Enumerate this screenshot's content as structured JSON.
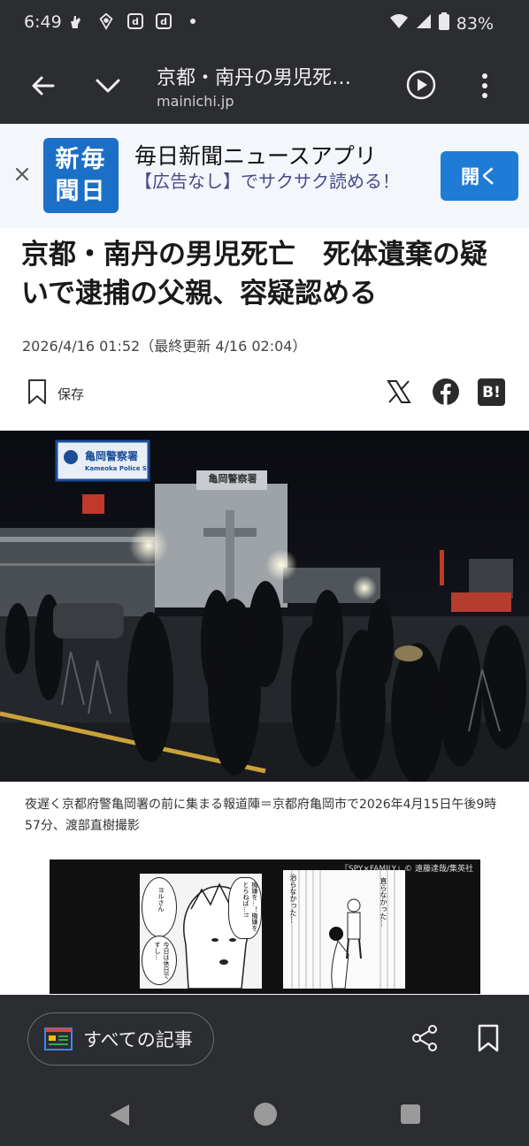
{
  "status_bar": {
    "time": "6:49",
    "battery": "83%"
  },
  "app_bar": {
    "title": "京都・南丹の男児死…",
    "domain": "mainichi.jp"
  },
  "ad_banner": {
    "logo_top": "新毎",
    "logo_bottom": "聞日",
    "title": "毎日新聞ニュースアプリ",
    "subtitle": "【広告なし】でサクサク読める！",
    "open_label": "開く"
  },
  "article": {
    "headline": "京都・南丹の男児死亡　死体遺棄の疑いで逮捕の父親、容疑認める",
    "date": "2026/4/16 01:52（最終更新 4/16 02:04）",
    "save_label": "保存",
    "hatena_label": "B!",
    "photo_sign_name": "亀岡警察署",
    "photo_sign_en": "Kameoka Police Sta.",
    "photo_building_sign": "亀岡警察署",
    "caption": "夜遅く京都府警亀岡署の前に集まる報道陣＝京都府亀岡市で2026年4月15日午後9時57分、渡部直樹撮影"
  },
  "manga_ad": {
    "copyright": "『SPY×FAMILY』© 遠藤達哉/集英社",
    "bubble1": "機嫌を…！機嫌をとらねば…!!",
    "bubble2": "ヨルさん",
    "bubble3": "今日は休日ですし…",
    "bubble4": "直らなかった…",
    "bubble5": "治らなかった…"
  },
  "bottom_bar": {
    "all_articles_label": "すべての記事"
  },
  "colors": {
    "chrome": "#2b2d30",
    "ad_blue": "#1f7cd6",
    "logo_blue": "#1c6fc7"
  }
}
